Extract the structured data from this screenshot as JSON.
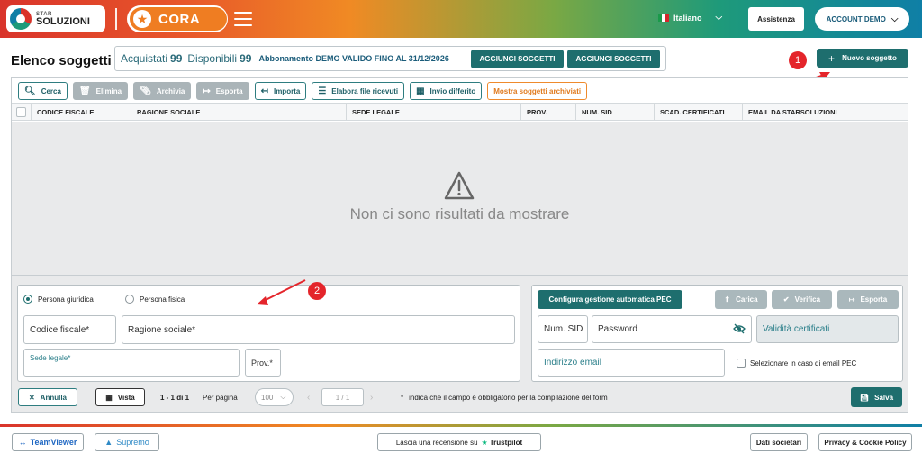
{
  "header": {
    "logo_top": "STAR",
    "logo_bottom": "SOLUZIONI",
    "app_name": "CORA",
    "language": "Italiano",
    "assistance": "Assistenza",
    "account": "ACCOUNT DEMO"
  },
  "page": {
    "title": "Elenco soggetti",
    "acquistati_label": "Acquistati",
    "acquistati_value": "99",
    "disponibili_label": "Disponibili",
    "disponibili_value": "99",
    "abbonamento": "Abbonamento DEMO VALIDO FINO AL 31/12/2026",
    "add_btn_1": "AGGIUNGI SOGGETTI",
    "add_btn_2": "AGGIUNGI SOGGETTI",
    "new_subject": "Nuovo soggetto",
    "badge_1": "1",
    "badge_2": "2"
  },
  "toolbar": {
    "cerca": "Cerca",
    "elimina": "Elimina",
    "archivia": "Archivia",
    "esporta": "Esporta",
    "importa": "Importa",
    "elabora": "Elabora file ricevuti",
    "invio": "Invio differito",
    "mostra": "Mostra soggetti archiviati"
  },
  "table": {
    "columns": [
      "CODICE FISCALE",
      "RAGIONE SOCIALE",
      "SEDE LEGALE",
      "PROV.",
      "NUM. SID",
      "SCAD. CERTIFICATI",
      "EMAIL DA STARSOLUZIONI"
    ],
    "empty_message": "Non ci sono risultati da mostrare"
  },
  "form": {
    "radio_giuridica": "Persona giuridica",
    "radio_fisica": "Persona fisica",
    "codice_fiscale": "Codice fiscale*",
    "ragione_sociale": "Ragione sociale*",
    "sede_legale": "Sede legale*",
    "prov": "Prov.*",
    "configura_pec": "Configura gestione automatica PEC",
    "carica": "Carica",
    "verifica": "Verifica",
    "esporta": "Esporta",
    "num_sid": "Num. SID",
    "password": "Password",
    "validita": "Validità certificati",
    "indirizzo_email": "Indirizzo email",
    "selezionare_pec": "Selezionare in caso di email PEC"
  },
  "bottom": {
    "annulla": "Annulla",
    "vista": "Vista",
    "range": "1 - 1 di 1",
    "per_pagina": "Per pagina",
    "per_pagina_value": "100",
    "page_indicator": "1 / 1",
    "note": "indica che il campo è obbligatorio per la compilazione del form",
    "note_star": "*",
    "salva": "Salva"
  },
  "footer": {
    "teamviewer": "TeamViewer",
    "supremo": "Supremo",
    "review": "Lascia una recensione su",
    "trustpilot": "Trustpilot",
    "dati": "Dati societari",
    "privacy": "Privacy & Cookie Policy"
  },
  "colors": {
    "primary": "#1e6e6e",
    "accent_orange": "#ef7d22",
    "badge_red": "#e4252b"
  }
}
